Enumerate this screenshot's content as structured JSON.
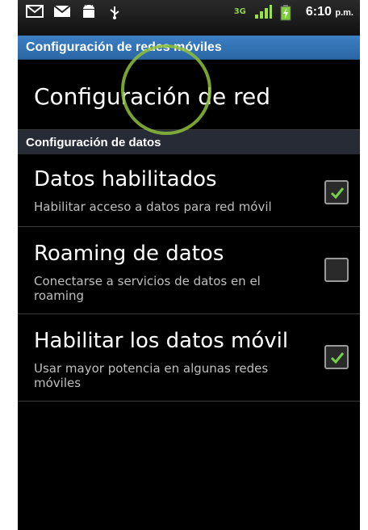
{
  "status_bar": {
    "left_icons": [
      "gmail-icon",
      "email-icon",
      "android-icon",
      "usb-icon"
    ],
    "network_type": "3G",
    "time": "6:10",
    "time_suffix": "p.m."
  },
  "title_bar": {
    "title": "Configuración de redes móviles"
  },
  "items": {
    "network_settings": {
      "label": "Configuración de red"
    },
    "data_section": {
      "label": "Configuración de datos"
    },
    "data_enabled": {
      "label": "Datos habilitados",
      "summary": "Habilitar acceso a datos para red móvil",
      "checked": true
    },
    "data_roaming": {
      "label": "Roaming de datos",
      "summary": "Conectarse a servicios de datos en el roaming",
      "checked": false
    },
    "enable_mobile_data": {
      "label": "Habilitar los datos móvil",
      "summary": "Usar mayor potencia en algunas redes móviles",
      "checked": true
    }
  },
  "colors": {
    "accent_title": "#3c7fc3",
    "section_bg": "#262b36",
    "check_green": "#74d04a",
    "ring": "#8dbf3a"
  }
}
